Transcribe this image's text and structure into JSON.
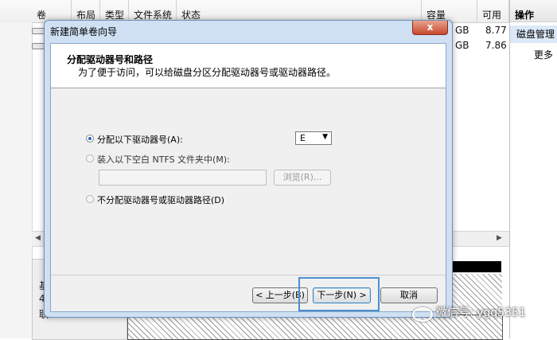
{
  "console": {
    "columns": [
      "卷",
      "布局",
      "类型",
      "文件系统",
      "状态",
      "容量",
      "可用"
    ],
    "rows": [
      {
        "capacity_unit": "GB",
        "free": "8.77"
      },
      {
        "capacity_unit": "GB",
        "free": "7.86"
      }
    ],
    "lower_labels": [
      "基",
      "4",
      "联"
    ],
    "actions": {
      "header": "操作",
      "item": "磁盘管理",
      "more": "更多"
    }
  },
  "wizard": {
    "title": "新建简单卷向导",
    "close": "x",
    "heading": "分配驱动器号和路径",
    "subheading": "为了便于访问，可以给磁盘分区分配驱动器号或驱动器路径。",
    "options": {
      "assign_letter": "分配以下驱动器号(A):",
      "mount_folder": "装入以下空白 NTFS 文件夹中(M):",
      "no_assign": "不分配驱动器号或驱动器路径(D)"
    },
    "drive_letter": "E",
    "browse": "浏览(R)...",
    "buttons": {
      "back": "< 上一步(B)",
      "next": "下一步(N) >",
      "cancel": "取消"
    }
  },
  "watermark": "微信号: ygq5351"
}
